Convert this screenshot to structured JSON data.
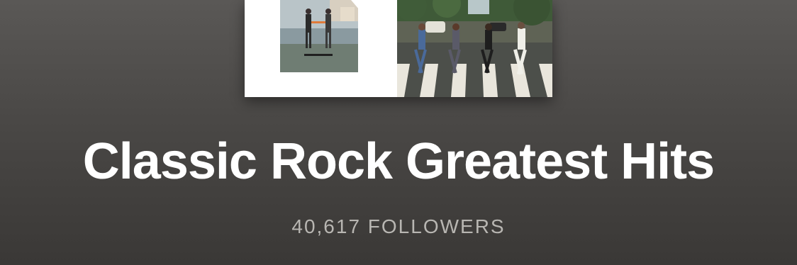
{
  "playlist": {
    "title": "Classic Rock Greatest Hits",
    "followers": "40,617 FOLLOWERS",
    "cover": {
      "left_art": "album-cover-handshake-icon",
      "right_art": "album-cover-crosswalk-icon"
    }
  },
  "colors": {
    "background_top": "#5a5856",
    "background_bottom": "#3a3836",
    "title": "#ffffff",
    "followers": "#b8b6b2"
  }
}
